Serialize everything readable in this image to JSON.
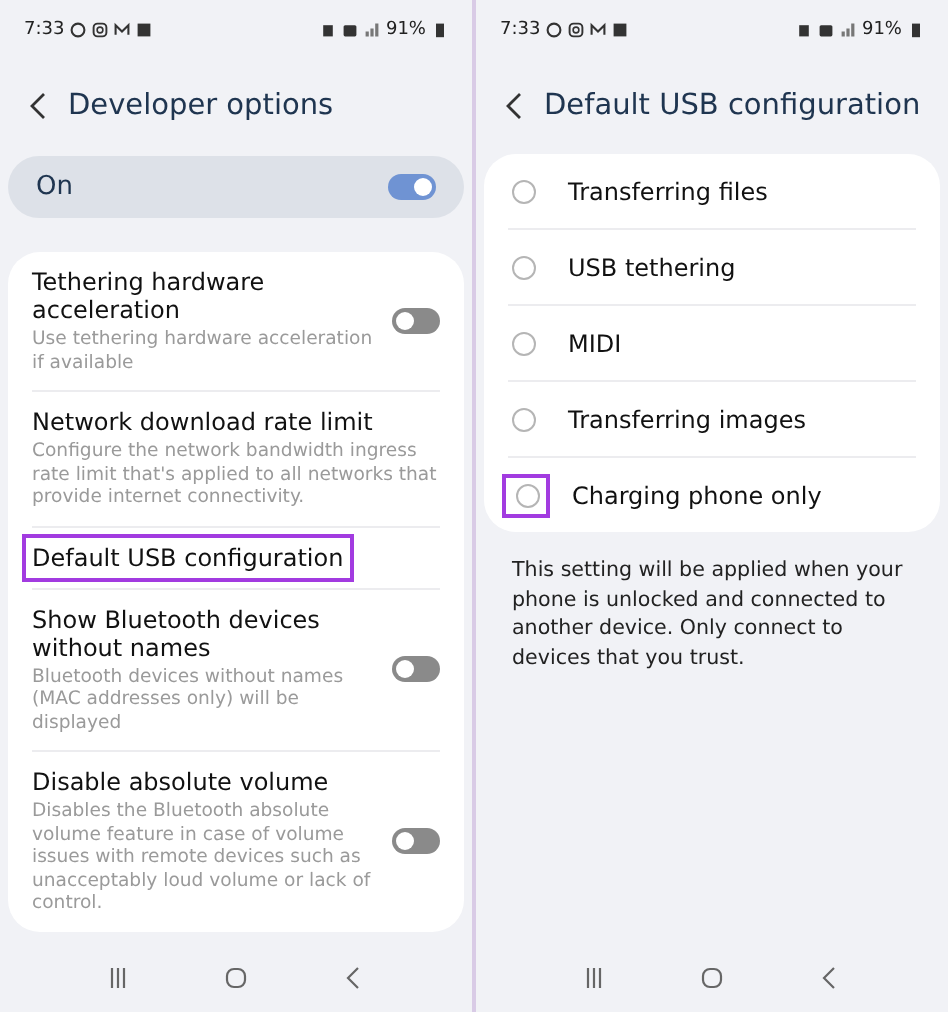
{
  "left_screen": {
    "status_bar": {
      "time": "7:33",
      "battery": "91%"
    },
    "title": "Developer options",
    "master_switch": {
      "label": "On",
      "on": true
    },
    "settings": [
      {
        "kind": "toggle",
        "title": "Tethering hardware acceleration",
        "description": "Use tethering hardware acceleration if available",
        "on": false,
        "highlighted": false
      },
      {
        "kind": "link",
        "title": "Network download rate limit",
        "description": "Configure the network bandwidth ingress rate limit that's applied to all networks that provide internet connectivity.",
        "highlighted": false
      },
      {
        "kind": "link",
        "title": "Default USB configuration",
        "highlighted": true
      },
      {
        "kind": "toggle",
        "title": "Show Bluetooth devices without names",
        "description": "Bluetooth devices without names (MAC addresses only) will be displayed",
        "on": false,
        "highlighted": false
      },
      {
        "kind": "toggle",
        "title": "Disable absolute volume",
        "description": "Disables the Bluetooth absolute volume feature in case of volume issues with remote devices such as unacceptably loud volume or lack of control.",
        "on": false,
        "highlighted": false
      }
    ]
  },
  "right_screen": {
    "status_bar": {
      "time": "7:33",
      "battery": "91%"
    },
    "title": "Default USB configuration",
    "options": [
      {
        "label": "Transferring files",
        "selected": false,
        "highlighted": false
      },
      {
        "label": "USB tethering",
        "selected": false,
        "highlighted": false
      },
      {
        "label": "MIDI",
        "selected": false,
        "highlighted": false
      },
      {
        "label": "Transferring images",
        "selected": false,
        "highlighted": false
      },
      {
        "label": "Charging phone only",
        "selected": false,
        "highlighted": true
      }
    ],
    "note": "This setting will be applied when your phone is unlocked and connected to another device. Only connect to devices that you trust."
  }
}
